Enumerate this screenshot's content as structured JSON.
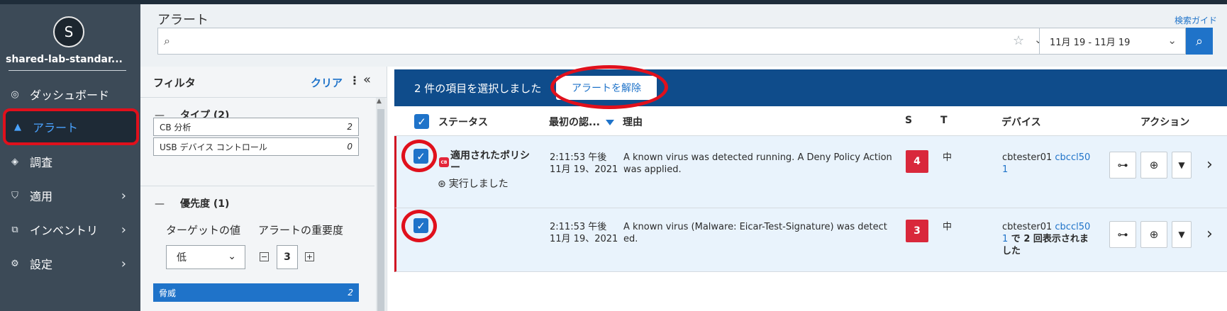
{
  "sidebar": {
    "avatar_letter": "S",
    "tenant": "shared-lab-standar...",
    "items": [
      {
        "label": "ダッシュボード",
        "icon": "dashboard-icon"
      },
      {
        "label": "アラート",
        "icon": "alert-triangle-icon"
      },
      {
        "label": "調査",
        "icon": "investigate-icon"
      },
      {
        "label": "適用",
        "icon": "shield-check-icon"
      },
      {
        "label": "インベントリ",
        "icon": "inventory-icon"
      },
      {
        "label": "設定",
        "icon": "gear-icon"
      }
    ]
  },
  "header": {
    "title": "アラート",
    "search_guide": "検索ガイド",
    "search_value": "",
    "date_range": "11月 19 - 11月 19"
  },
  "filter": {
    "title": "フィルタ",
    "clear": "クリア",
    "type_section": "タイプ (2)",
    "type_options": [
      {
        "label": "CB 分析",
        "count": "2"
      },
      {
        "label": "USB デバイス コントロール",
        "count": "0"
      }
    ],
    "priority_section": "優先度 (1)",
    "target_value_label": "ターゲットの値",
    "alert_severity_label": "アラートの重要度",
    "target_value_selected": "低",
    "severity_value": "3",
    "chip": {
      "label": "脅威",
      "count": "2"
    }
  },
  "selection": {
    "count_text": "2 件の項目を選択しました",
    "dismiss_label": "アラートを解除"
  },
  "table": {
    "headers": {
      "status": "ステータス",
      "first_seen": "最初の認...",
      "reason": "理由",
      "s": "S",
      "t": "T",
      "device": "デバイス",
      "action": "アクション"
    },
    "rows": [
      {
        "policy_line1": "適用されたポリシ",
        "policy_line2": "ー",
        "badge": "CB",
        "executed": "実行しました",
        "time": "2:11:53 午後",
        "date": "11月 19、2021",
        "reason_line1": "A known virus was detected running. A Deny Policy Action",
        "reason_line2": "was applied.",
        "severity": "4",
        "t_value": "中",
        "device_name": "cbtester01",
        "device_link_a": "cbccl50",
        "device_link_b": "1",
        "device_extra_a": "",
        "device_extra_b": ""
      },
      {
        "time": "2:11:53 午後",
        "date": "11月 19、2021",
        "reason_line1": "A known virus (Malware: Eicar-Test-Signature) was detect",
        "reason_line2": "ed.",
        "severity": "3",
        "t_value": "中",
        "device_name": "cbtester01",
        "device_link_a": "cbccl50",
        "device_link_b": "1",
        "device_extra_a": " で 2 回表示されま",
        "device_extra_b": "した"
      }
    ]
  },
  "colors": {
    "sidebar_bg": "#3c4a57",
    "accent": "#1f73c9",
    "selection_bar": "#0f4c8b",
    "annotation_ring": "#e0101c",
    "severity_badge": "#d9283b"
  }
}
